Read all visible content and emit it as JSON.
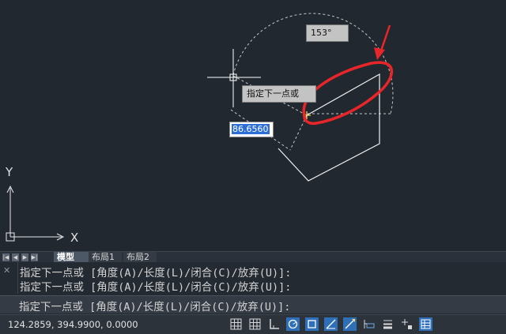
{
  "canvas": {
    "angle_tooltip": "153°",
    "prompt_tooltip": "指定下一点或",
    "length_input_value": "86.6560",
    "axis_y_label": "Y",
    "axis_x_label": "X"
  },
  "tabs": {
    "nav_buttons": [
      "first-icon",
      "prev-icon",
      "next-icon",
      "last-icon"
    ],
    "items": [
      {
        "label": "模型",
        "active": true
      },
      {
        "label": "布局1",
        "active": false
      },
      {
        "label": "布局2",
        "active": false
      }
    ]
  },
  "command": {
    "history": [
      "指定下一点或 [角度(A)/长度(L)/闭合(C)/放弃(U)]:",
      "指定下一点或 [角度(A)/长度(L)/闭合(C)/放弃(U)]:"
    ],
    "current": "指定下一点或 [角度(A)/长度(L)/闭合(C)/放弃(U)]:"
  },
  "status": {
    "coordinates": "124.2859, 394.9900, 0.0000",
    "toggles": [
      "grid-icon",
      "snap-icon",
      "ortho-icon",
      "polar-icon",
      "osnap-icon",
      "otrack-icon",
      "dynucs-icon",
      "dynamic-input-icon",
      "lineweight-icon",
      "selection-cycle-icon",
      "quick-properties-icon"
    ]
  },
  "colors": {
    "canvas_bg": "#212830",
    "annotation_red": "#e8262a",
    "input_highlight": "#2d6fd6"
  }
}
